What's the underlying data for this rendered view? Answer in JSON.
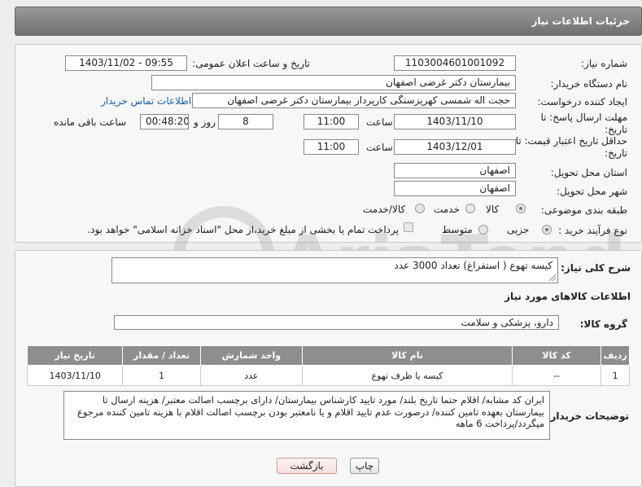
{
  "header": {
    "title": "جزئیات اطلاعات نیاز"
  },
  "form": {
    "need_number_label": "شماره نیاز:",
    "need_number": "1103004601001092",
    "announce_label": "تاریخ و ساعت اعلان عمومی:",
    "announce_value": "1403/11/02 - 09:55",
    "buyer_org_label": "نام دستگاه خریدار:",
    "buyer_org": "بیمارستان دکتر غرضی اصفهان",
    "requester_label": "ایجاد کننده درخواست:",
    "requester": "حجت اله شمسی کهریزسنگی کارپرداز بیمارستان دکتر غرضی اصفهان",
    "contact_link": "اطلاعات تماس خریدار",
    "deadline_label": "مهلت ارسال پاسخ: تا تاریخ:",
    "deadline_date": "1403/11/10",
    "time_label": "ساعت",
    "deadline_time": "11:00",
    "days_value": "8",
    "days_label": "روز و",
    "remaining_value": "00:48:20",
    "remaining_label": "ساعت باقی مانده",
    "validity_label": "حداقل تاریخ اعتبار قیمت: تا تاریخ:",
    "validity_date": "1403/12/01",
    "validity_time": "11:00",
    "province_label": "استان محل تحویل:",
    "province": "اصفهان",
    "city_label": "شهر محل تحویل:",
    "city": "اصفهان",
    "category_label": "طبقه بندی موضوعی:",
    "category_options": [
      "کالا",
      "خدمت",
      "کالا/خدمت"
    ],
    "purchase_type_label": "نوع فرآیند خرید :",
    "purchase_options": [
      "جزیی",
      "متوسط"
    ],
    "payment_note": "پرداخت تمام یا بخشی از مبلغ خرید،از محل \"اسناد خزانه اسلامی\" خواهد بود."
  },
  "description": {
    "label": "شرح کلی نیاز:",
    "value": "کیسه تهوع ( استفراغ) تعداد 3000 عدد"
  },
  "goods": {
    "section_title": "اطلاعات کالاهای مورد نیاز",
    "group_label": "گروه کالا:",
    "group_value": "دارو، پزشکی و سلامت",
    "columns": [
      "ردیف",
      "کد کالا",
      "نام کالا",
      "واحد شمارش",
      "تعداد / مقدار",
      "تاریخ نیاز"
    ],
    "rows": [
      [
        "1",
        "--",
        "کیسه یا ظرف تهوع",
        "عدد",
        "1",
        "1403/11/10"
      ]
    ]
  },
  "buyer_notes": {
    "label": "توضیحات خریدار:",
    "value": "ایران کد مشابه/ اقلام حتما تاریخ بلند/ مورد تایید کارشناس بیمارستان/ دارای برچسب اصالت معتبر/ هزینه ارسال تا بیمارستان بعهده تامین کننده/ درصورت عدم تایید اقلام و یا نامعتبر بودن برچسب اصالت اقلام با هزینه تامین کننده مرجوع میگردد/پرداخت 6 ماهه"
  },
  "buttons": {
    "print": "چاپ",
    "back": "بازگشت"
  },
  "watermark": {
    "text": "AriaTender.net"
  },
  "colors": {
    "header_bg": "#7f7f7f",
    "table_header_bg": "#8e8e8e",
    "link": "#1a5fb4",
    "back_button_bg": "#f7dede"
  }
}
